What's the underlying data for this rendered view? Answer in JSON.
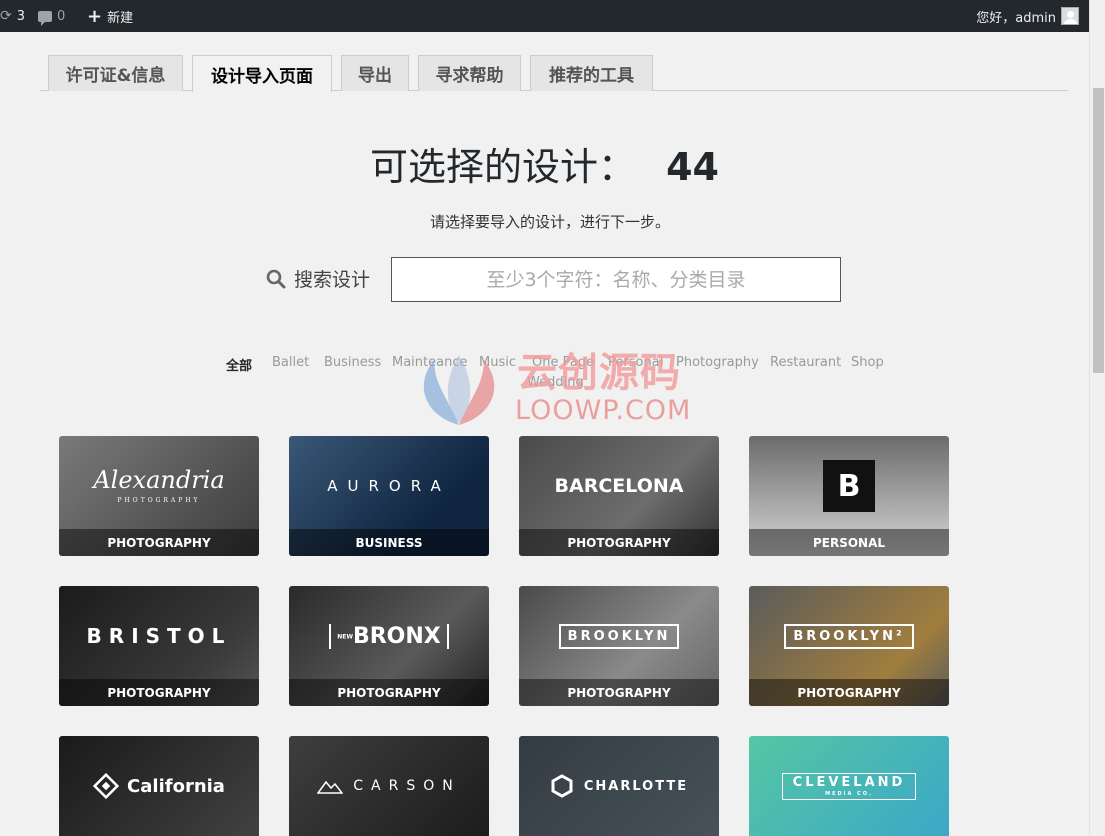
{
  "admin_bar": {
    "updates_count": "3",
    "comments_count": "0",
    "new_label": "新建",
    "account_label": "您好，admin"
  },
  "tabs": [
    {
      "label": "许可证&信息"
    },
    {
      "label": "设计导入页面"
    },
    {
      "label": "导出"
    },
    {
      "label": "寻求帮助"
    },
    {
      "label": "推荐的工具"
    }
  ],
  "main": {
    "heading": "可选择的设计：",
    "count": "44",
    "subtext": "请选择要导入的设计，进行下一步。",
    "search_label": "搜索设计",
    "search_placeholder": "至少3个字符：名称、分类目录"
  },
  "categories": [
    "全部",
    "Ballet",
    "Business",
    "Mainteance",
    "Music",
    "One Page",
    "Personal",
    "Photography",
    "Restaurant",
    "Shop",
    "Wedding"
  ],
  "watermark": {
    "text": "云创源码",
    "url": "LOOWP.COM"
  },
  "designs": [
    {
      "name": "Alexandria",
      "sub": "PHOTOGRAPHY",
      "category": "PHOTOGRAPHY"
    },
    {
      "name": "AURORA",
      "category": "BUSINESS"
    },
    {
      "name": "BARCELONA",
      "category": "PHOTOGRAPHY"
    },
    {
      "name": "B",
      "category": "PERSONAL"
    },
    {
      "name": "BRISTOL",
      "category": "PHOTOGRAPHY"
    },
    {
      "name": "BRONX",
      "prefix": "NEW",
      "category": "PHOTOGRAPHY"
    },
    {
      "name": "BROOKLYN",
      "category": "PHOTOGRAPHY"
    },
    {
      "name": "BROOKLYN²",
      "category": "PHOTOGRAPHY"
    },
    {
      "name": "California"
    },
    {
      "name": "CARSON"
    },
    {
      "name": "CHARLOTTE"
    },
    {
      "name": "CLEVELAND",
      "sub": "MEDIA CO."
    }
  ]
}
